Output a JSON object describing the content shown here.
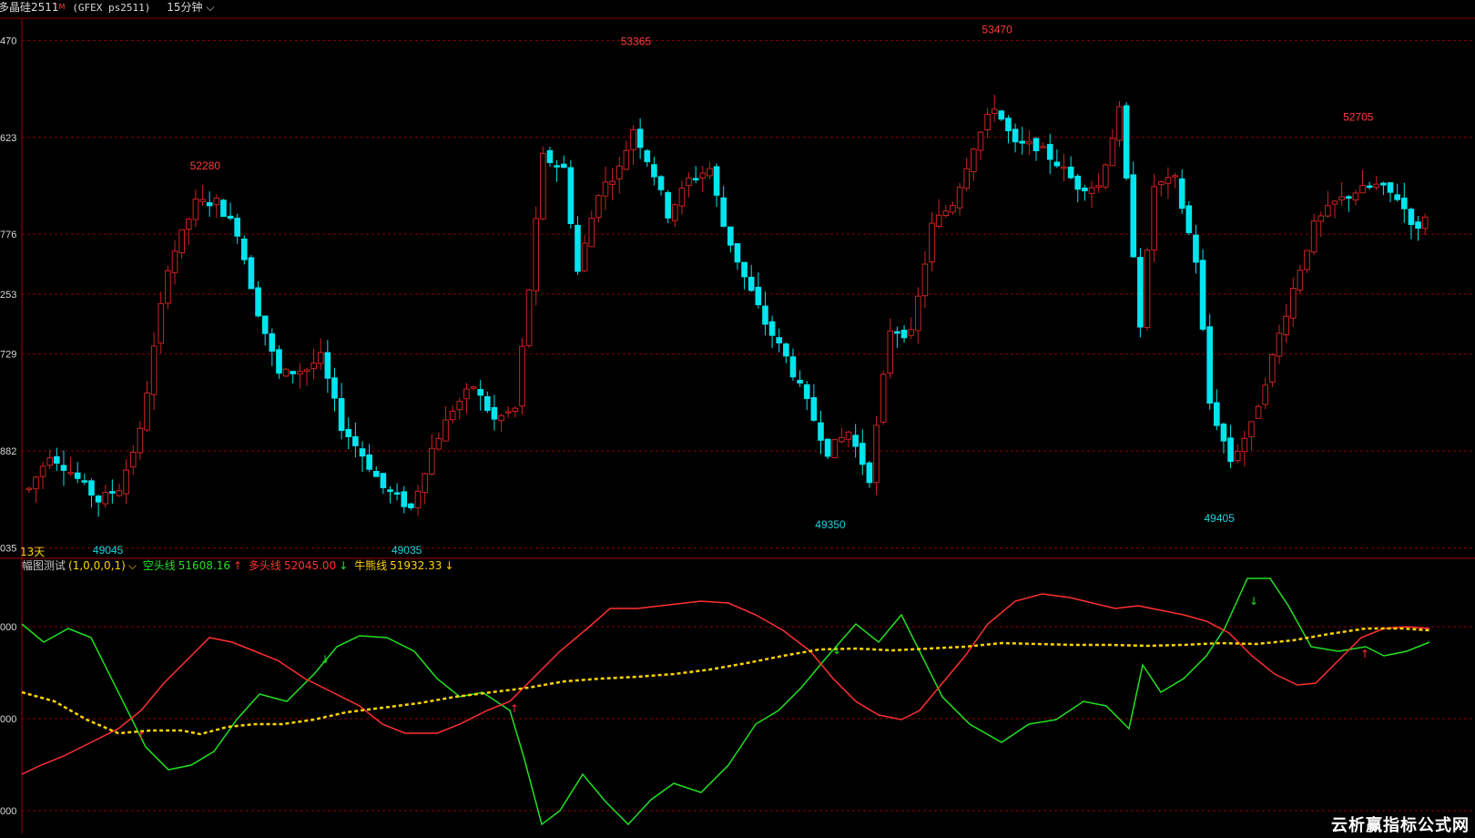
{
  "header": {
    "symbol": "多晶硅2511",
    "symbol_mark": "M",
    "exchange_code": "(GFEX ps2511)",
    "period": "15分钟"
  },
  "price_axis": {
    "ticks": [
      {
        "label": "470",
        "value": 53470
      },
      {
        "label": "623",
        "value": 52623
      },
      {
        "label": "776",
        "value": 51776
      },
      {
        "label": "253",
        "value": 51253
      },
      {
        "label": "729",
        "value": 50729
      },
      {
        "label": "882",
        "value": 49882
      },
      {
        "label": "035",
        "value": 49035
      }
    ]
  },
  "annotations": {
    "highs": [
      {
        "text": "52280",
        "bar": 25
      },
      {
        "text": "53365",
        "bar": 87
      },
      {
        "text": "53470",
        "bar": 139
      },
      {
        "text": "52705",
        "bar": 191
      }
    ],
    "lows": [
      {
        "text": "49045",
        "bar": 11
      },
      {
        "text": "49035",
        "bar": 54
      },
      {
        "text": "49350",
        "bar": 115
      },
      {
        "text": "49405",
        "bar": 171
      }
    ]
  },
  "day_count": "13天",
  "indicator": {
    "name": "幅图测试",
    "params": "(1,0,0,0,1)",
    "lines": [
      {
        "label": "空头线",
        "value": "51608.16",
        "arrow": "↑",
        "color": "#22e022"
      },
      {
        "label": "多头线",
        "value": "52045.00",
        "arrow": "↓",
        "color": "#ff3030"
      },
      {
        "label": "牛熊线",
        "value": "51932.33",
        "arrow": "↓",
        "color": "#ffd400"
      }
    ],
    "axis_labels": [
      "000",
      "000",
      "000"
    ]
  },
  "watermark": "云析赢指标公式网",
  "colors": {
    "up": "#ff2a2a",
    "down": "#00e5ee",
    "grid": "#8b0000",
    "bear_line": "#22e022",
    "bull_line": "#ff3030",
    "trend_line": "#ffd400"
  }
}
